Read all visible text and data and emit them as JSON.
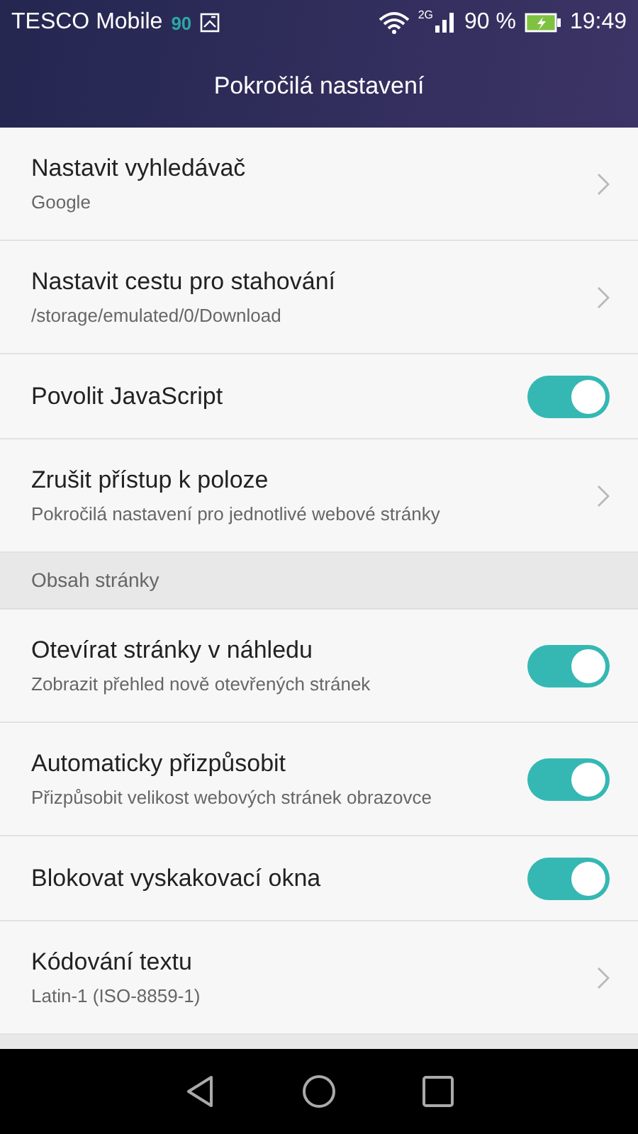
{
  "status_bar": {
    "carrier": "TESCO Mobile",
    "carrier_badge": "90",
    "network": "2G",
    "battery": "90 %",
    "time": "19:49"
  },
  "header": {
    "title": "Pokročilá nastavení"
  },
  "sections": [
    {
      "items": [
        {
          "kind": "link",
          "title": "Nastavit vyhledávač",
          "subtitle": "Google"
        },
        {
          "kind": "link",
          "title": "Nastavit cestu pro stahování",
          "subtitle": "/storage/emulated/0/Download"
        },
        {
          "kind": "toggle",
          "title": "Povolit JavaScript",
          "on": true
        },
        {
          "kind": "link",
          "title": "Zrušit přístup k poloze",
          "subtitle": "Pokročilá nastavení pro jednotlivé webové stránky"
        }
      ]
    },
    {
      "heading": "Obsah stránky",
      "items": [
        {
          "kind": "toggle",
          "title": "Otevírat stránky v náhledu",
          "subtitle": "Zobrazit přehled nově otevřených stránek",
          "on": true
        },
        {
          "kind": "toggle",
          "title": "Automaticky přizpůsobit",
          "subtitle": "Přizpůsobit velikost webových stránek obrazovce",
          "on": true
        },
        {
          "kind": "toggle",
          "title": "Blokovat vyskakovací okna",
          "on": true
        },
        {
          "kind": "link",
          "title": "Kódování textu",
          "subtitle": "Latin-1 (ISO-8859-1)"
        }
      ]
    }
  ]
}
